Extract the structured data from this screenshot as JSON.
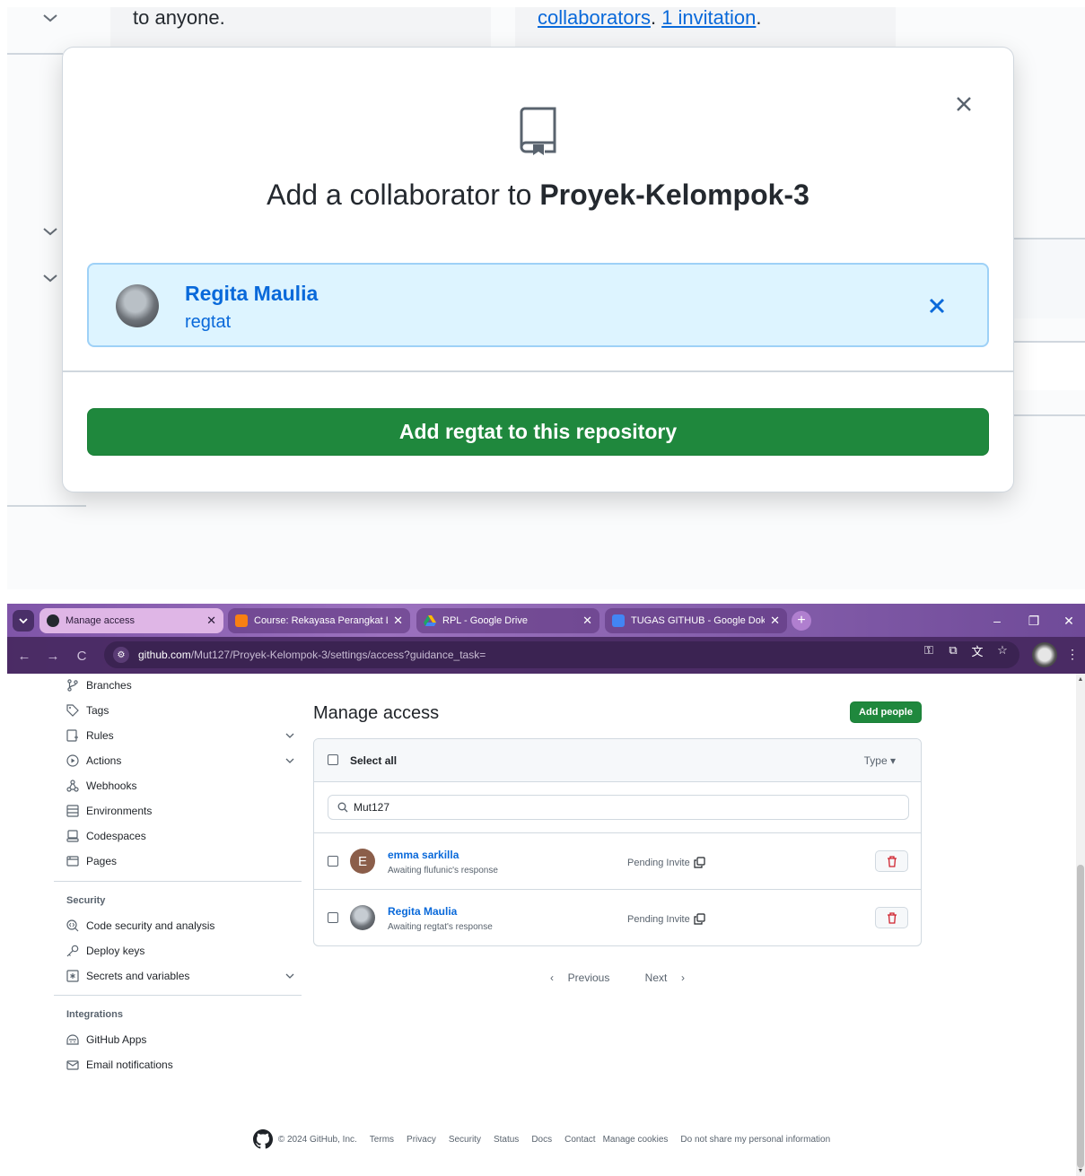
{
  "zoom_view": {
    "bg_text_left": "to anyone.",
    "bg_link_1": "collaborators",
    "bg_link_sep": ". ",
    "bg_link_2": "1 invitation",
    "bg_link_end": ".",
    "modal": {
      "title_prefix": "Add a collaborator to ",
      "repo_name": "Proyek-Kelompok-3",
      "collaborator_name": "Regita Maulia",
      "collaborator_login": "regtat",
      "add_button": "Add regtat to this repository"
    }
  },
  "browser": {
    "tabs": [
      {
        "label": "Manage access",
        "active": true
      },
      {
        "label": "Course: Rekayasa Perangkat Lu",
        "active": false
      },
      {
        "label": "RPL - Google Drive",
        "active": false
      },
      {
        "label": "TUGAS GITHUB - Google Doku",
        "active": false
      }
    ],
    "url_host": "github.com",
    "url_path": "/Mut127/Proyek-Kelompok-3/settings/access?guidance_task="
  },
  "sidebar": {
    "items": [
      {
        "label": "Branches"
      },
      {
        "label": "Tags"
      },
      {
        "label": "Rules"
      },
      {
        "label": "Actions"
      },
      {
        "label": "Webhooks"
      },
      {
        "label": "Environments"
      },
      {
        "label": "Codespaces"
      },
      {
        "label": "Pages"
      }
    ],
    "security_heading": "Security",
    "security_items": [
      {
        "label": "Code security and analysis"
      },
      {
        "label": "Deploy keys"
      },
      {
        "label": "Secrets and variables"
      }
    ],
    "integrations_heading": "Integrations",
    "integrations_items": [
      {
        "label": "GitHub Apps"
      },
      {
        "label": "Email notifications"
      }
    ]
  },
  "main": {
    "title": "Manage access",
    "add_people": "Add people",
    "select_all": "Select all",
    "type_filter": "Type",
    "search_value": "Mut127",
    "members": [
      {
        "initial": "E",
        "name": "emma sarkilla",
        "sub": "Awaiting flufunic's response",
        "status": "Pending Invite"
      },
      {
        "initial": "",
        "name": "Regita Maulia",
        "sub": "Awaiting regtat's response",
        "status": "Pending Invite"
      }
    ],
    "pager_prev": "Previous",
    "pager_next": "Next"
  },
  "footer": {
    "copyright": "© 2024 GitHub, Inc.",
    "links": [
      "Terms",
      "Privacy",
      "Security",
      "Status",
      "Docs",
      "Contact",
      "Manage cookies",
      "Do not share my personal information"
    ]
  },
  "colors": {
    "primary_button": "#1f883d",
    "link": "#0969da",
    "danger": "#cf222e",
    "chrome_theme": "#8a63b0"
  }
}
